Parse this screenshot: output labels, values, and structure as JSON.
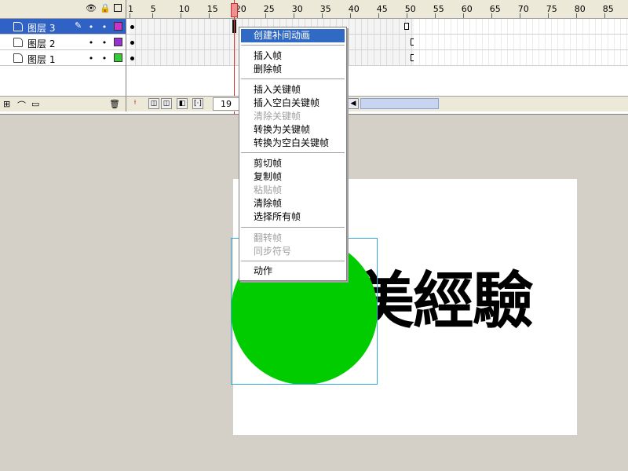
{
  "timeline": {
    "header_icons": [
      "eye-icon",
      "lock-icon",
      "outline-icon"
    ],
    "ruler_ticks": [
      "1",
      "5",
      "10",
      "15",
      "20",
      "25",
      "30",
      "35",
      "40",
      "45",
      "50",
      "55",
      "60",
      "65",
      "70",
      "75",
      "80",
      "85"
    ],
    "layers": [
      {
        "name": "图层 3",
        "color": "#cc33cc",
        "selected": true
      },
      {
        "name": "图层 2",
        "color": "#9933cc",
        "selected": false
      },
      {
        "name": "图层 1",
        "color": "#33cc33",
        "selected": false
      }
    ],
    "current_frame": "19"
  },
  "stage": {
    "text": "美經驗",
    "circle_color": "#00cc00"
  },
  "context_menu": {
    "items": [
      {
        "label": "创建补间动画",
        "state": "highlighted"
      },
      {
        "label": "插入帧",
        "state": "enabled"
      },
      {
        "label": "删除帧",
        "state": "enabled"
      },
      {
        "label": "插入关键帧",
        "state": "enabled"
      },
      {
        "label": "插入空白关键帧",
        "state": "enabled"
      },
      {
        "label": "清除关键帧",
        "state": "disabled"
      },
      {
        "label": "转换为关键帧",
        "state": "enabled"
      },
      {
        "label": "转换为空白关键帧",
        "state": "enabled"
      },
      {
        "label": "剪切帧",
        "state": "enabled"
      },
      {
        "label": "复制帧",
        "state": "enabled"
      },
      {
        "label": "粘贴帧",
        "state": "disabled"
      },
      {
        "label": "清除帧",
        "state": "enabled"
      },
      {
        "label": "选择所有帧",
        "state": "enabled"
      },
      {
        "label": "翻转帧",
        "state": "disabled"
      },
      {
        "label": "同步符号",
        "state": "disabled"
      },
      {
        "label": "动作",
        "state": "enabled"
      }
    ]
  }
}
